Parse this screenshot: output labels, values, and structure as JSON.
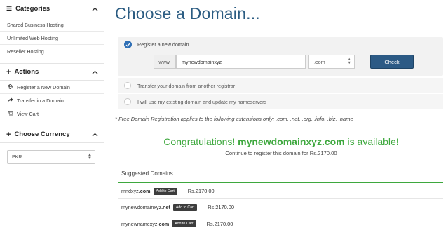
{
  "sidebar": {
    "categories": {
      "title": "Categories",
      "items": [
        "Shared Business Hosting",
        "Unlimited Web Hosting",
        "Reseller Hosting"
      ]
    },
    "actions": {
      "title": "Actions",
      "items": [
        {
          "label": "Register a New Domain",
          "icon": "globe-icon"
        },
        {
          "label": "Transfer in a Domain",
          "icon": "share-icon"
        },
        {
          "label": "View Cart",
          "icon": "cart-icon"
        }
      ]
    },
    "currency": {
      "title": "Choose Currency",
      "selected": "PKR"
    }
  },
  "main": {
    "title": "Choose a Domain...",
    "register_label": "Register a new domain",
    "www_prefix": "www.",
    "domain_value": "mynewdomainxyz",
    "tld_selected": ".com",
    "check_label": "Check",
    "transfer_label": "Transfer your domain from another registrar",
    "existing_label": "I will use my existing domain and update my nameservers",
    "note": "* Free Domain Registration applies to the following extensions only: .com, .net, .org, .info, .biz, .name",
    "congrats_prefix": "Congratulations!",
    "congrats_domain": "mynewdomainxyz.com",
    "congrats_suffix": "is available!",
    "continue_text": "Continue to register this domain for Rs.2170.00",
    "suggested_title": "Suggested Domains",
    "suggestions": [
      {
        "name": "mndxyz",
        "tld": ".com",
        "button": "Add to Cart",
        "price": "Rs.2170.00"
      },
      {
        "name": "mynewdomainxyz",
        "tld": ".net",
        "button": "Add to Cart",
        "price": "Rs.2170.00"
      },
      {
        "name": "mynewnamexyz",
        "tld": ".com",
        "button": "Add to Cart",
        "price": "Rs.2170.00"
      }
    ]
  },
  "colors": {
    "title_blue": "#2b5c82",
    "success_green": "#3ea83e",
    "button_blue": "#2c5a85",
    "radio_blue": "#2f6fb5"
  }
}
